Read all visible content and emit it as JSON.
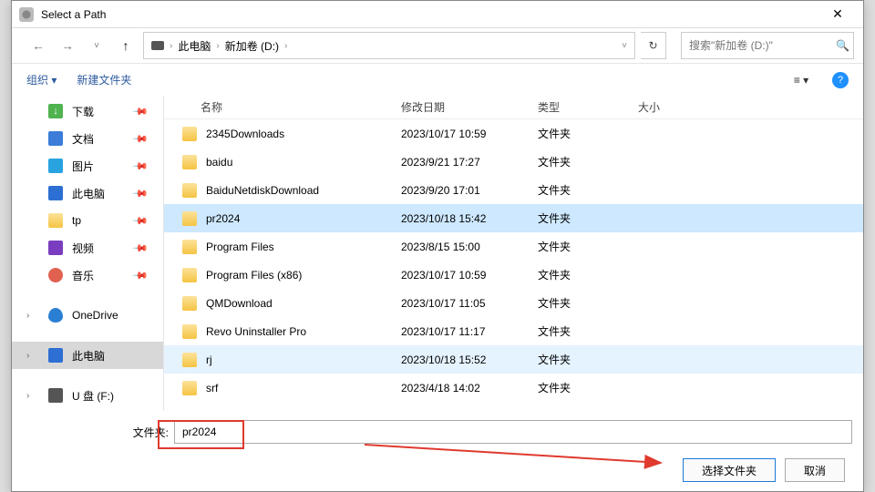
{
  "title": "Select a Path",
  "breadcrumb": {
    "root": "此电脑",
    "drive": "新加卷 (D:)"
  },
  "search_placeholder": "搜索\"新加卷 (D:)\"",
  "toolbar": {
    "organize": "组织",
    "newfolder": "新建文件夹"
  },
  "sidebar": [
    {
      "label": "下载",
      "icon": "dl",
      "pin": true
    },
    {
      "label": "文档",
      "icon": "doc",
      "pin": true
    },
    {
      "label": "图片",
      "icon": "img",
      "pin": true
    },
    {
      "label": "此电脑",
      "icon": "pc",
      "pin": true
    },
    {
      "label": "tp",
      "icon": "folder",
      "pin": true
    },
    {
      "label": "视频",
      "icon": "vid",
      "pin": true
    },
    {
      "label": "音乐",
      "icon": "mus",
      "pin": true
    },
    {
      "label": "OneDrive",
      "icon": "cloud",
      "pin": false,
      "exp": true
    },
    {
      "label": "此电脑",
      "icon": "pc",
      "pin": false,
      "sel": true,
      "exp": true
    },
    {
      "label": "U 盘 (F:)",
      "icon": "usb",
      "pin": false,
      "exp": true
    }
  ],
  "headers": {
    "name": "名称",
    "date": "修改日期",
    "type": "类型",
    "size": "大小"
  },
  "files": [
    {
      "name": "2345Downloads",
      "date": "2023/10/17 10:59",
      "type": "文件夹"
    },
    {
      "name": "baidu",
      "date": "2023/9/21 17:27",
      "type": "文件夹"
    },
    {
      "name": "BaiduNetdiskDownload",
      "date": "2023/9/20 17:01",
      "type": "文件夹"
    },
    {
      "name": "pr2024",
      "date": "2023/10/18 15:42",
      "type": "文件夹",
      "sel": true
    },
    {
      "name": "Program Files",
      "date": "2023/8/15 15:00",
      "type": "文件夹"
    },
    {
      "name": "Program Files (x86)",
      "date": "2023/10/17 10:59",
      "type": "文件夹"
    },
    {
      "name": "QMDownload",
      "date": "2023/10/17 11:05",
      "type": "文件夹"
    },
    {
      "name": "Revo Uninstaller Pro",
      "date": "2023/10/17 11:17",
      "type": "文件夹"
    },
    {
      "name": "rj",
      "date": "2023/10/18 15:52",
      "type": "文件夹",
      "hov": true
    },
    {
      "name": "srf",
      "date": "2023/4/18 14:02",
      "type": "文件夹"
    }
  ],
  "folder_label": "文件夹:",
  "folder_value": "pr2024",
  "buttons": {
    "select": "选择文件夹",
    "cancel": "取消"
  }
}
